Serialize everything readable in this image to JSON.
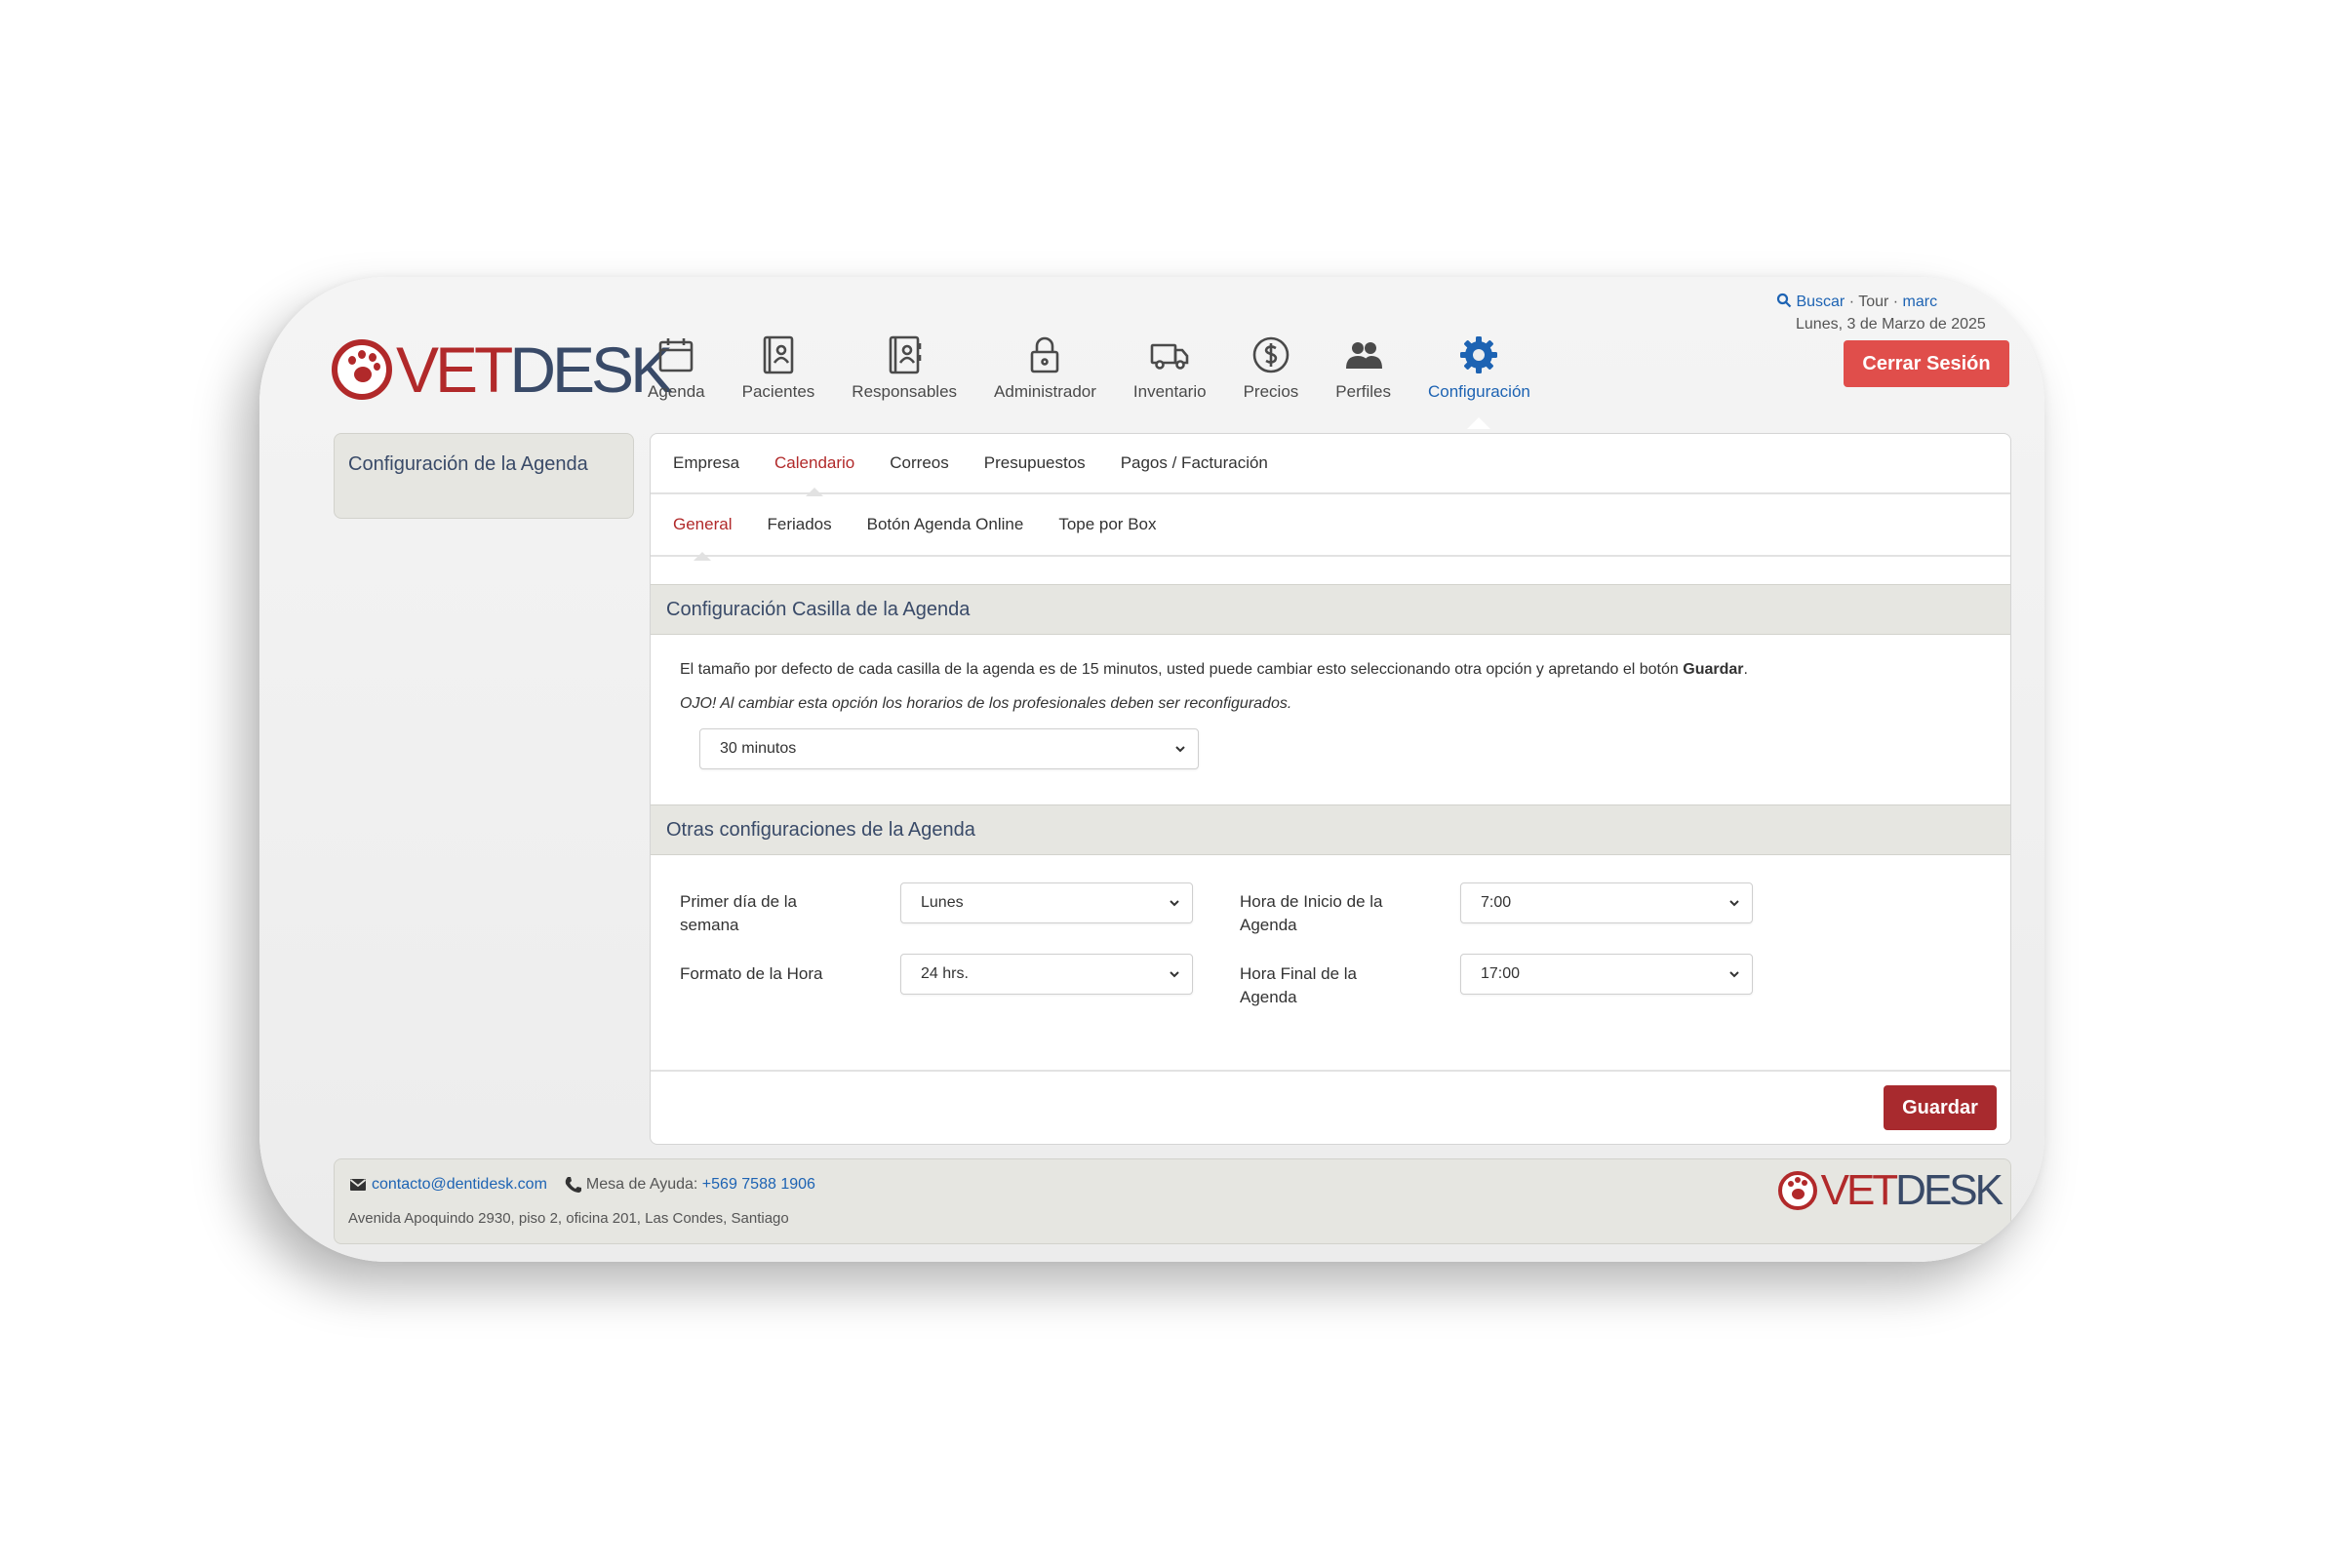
{
  "brand": {
    "vet": "VET",
    "desk": "DESK",
    "accent": "#b1292a",
    "navy": "#394a68",
    "link": "#1d63b3"
  },
  "nav": [
    {
      "label": "Agenda",
      "icon": "calendar-icon"
    },
    {
      "label": "Pacientes",
      "icon": "patient-card-icon"
    },
    {
      "label": "Responsables",
      "icon": "owner-card-icon"
    },
    {
      "label": "Administrador",
      "icon": "lock-icon"
    },
    {
      "label": "Inventario",
      "icon": "truck-icon"
    },
    {
      "label": "Precios",
      "icon": "dollar-icon"
    },
    {
      "label": "Perfiles",
      "icon": "users-icon"
    },
    {
      "label": "Configuración",
      "icon": "gear-icon",
      "active": true
    }
  ],
  "topbar": {
    "search": "Buscar",
    "sep": "·",
    "tour": "Tour",
    "user": "marc",
    "date": "Lunes, 3 de Marzo de 2025",
    "logout": "Cerrar Sesión"
  },
  "sidebar": {
    "title": "Configuración de la Agenda"
  },
  "tabs_primary": [
    "Empresa",
    "Calendario",
    "Correos",
    "Presupuestos",
    "Pagos / Facturación"
  ],
  "tabs_secondary": [
    "General",
    "Feriados",
    "Botón Agenda Online",
    "Tope por Box"
  ],
  "section1": {
    "title": "Configuración Casilla de la Agenda",
    "info": "El tamaño por defecto de cada casilla de la agenda es de 15 minutos, usted puede cambiar esto seleccionando otra opción y apretando el botón ",
    "info_bold": "Guardar",
    "info_end": ".",
    "warning": "OJO! Al cambiar esta opción los horarios de los profesionales deben ser reconfigurados.",
    "slot_value": "30 minutos"
  },
  "section2": {
    "title": "Otras configuraciones de la Agenda",
    "first_day": {
      "label": "Primer día de la semana",
      "value": "Lunes"
    },
    "hour_format": {
      "label": "Formato de la Hora",
      "value": "24 hrs."
    },
    "start_hour": {
      "label": "Hora de Inicio de la Agenda",
      "value": "7:00"
    },
    "end_hour": {
      "label": "Hora Final de la Agenda",
      "value": "17:00"
    }
  },
  "actions": {
    "save": "Guardar"
  },
  "footer": {
    "email": "contacto@dentidesk.com",
    "help_label": "Mesa de Ayuda:",
    "phone": "+569 7588 1906",
    "address": "Avenida Apoquindo 2930, piso 2, oficina 201, Las Condes, Santiago"
  }
}
